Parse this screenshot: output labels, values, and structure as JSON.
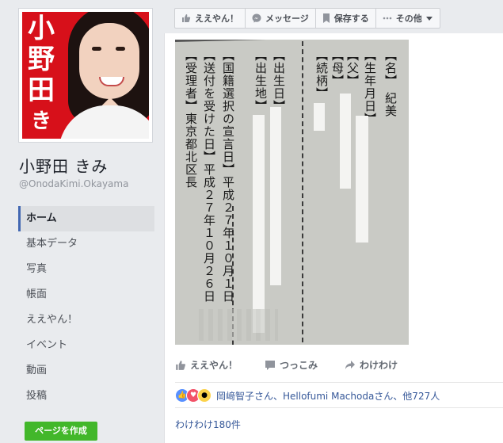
{
  "profile": {
    "avatar_text": [
      "小",
      "野",
      "田",
      "きみ"
    ],
    "name": "小野田 きみ",
    "handle": "@OnodaKimi.Okayama"
  },
  "nav": [
    {
      "label": "ホーム",
      "active": true
    },
    {
      "label": "基本データ",
      "active": false
    },
    {
      "label": "写真",
      "active": false
    },
    {
      "label": "帳面",
      "active": false
    },
    {
      "label": "ええやん！",
      "active": false
    },
    {
      "label": "イベント",
      "active": false
    },
    {
      "label": "動画",
      "active": false
    },
    {
      "label": "投稿",
      "active": false
    }
  ],
  "create_page_label": "ページを作成",
  "action_bar": {
    "like": "ええやん！",
    "message": "メッセージ",
    "save": "保存する",
    "more": "その他"
  },
  "document": {
    "col1": "【名】 紀美",
    "col2": "【生年月日】",
    "col3": "【父】",
    "col4": "【母】",
    "col5": "【続柄】",
    "col6": "【出生日】",
    "col7": "【出生地】",
    "col8": "【国籍選択の宣言日】平成２７年１０月１日",
    "col9": "【送付を受けた日】平成２７年１０月２６日",
    "col10": "【受理者】東京都北区長"
  },
  "post_actions": {
    "like": "ええやん！",
    "comment": "つっこみ",
    "share": "わけわけ"
  },
  "reactions_text": "岡﨑智子さん、Hellofumi Machodaさん、他727人",
  "shares_text": "わけわけ180件",
  "colors": {
    "brand_blue": "#4267b2",
    "link_blue": "#365899",
    "green": "#42b72a",
    "avatar_red": "#d7101a"
  }
}
